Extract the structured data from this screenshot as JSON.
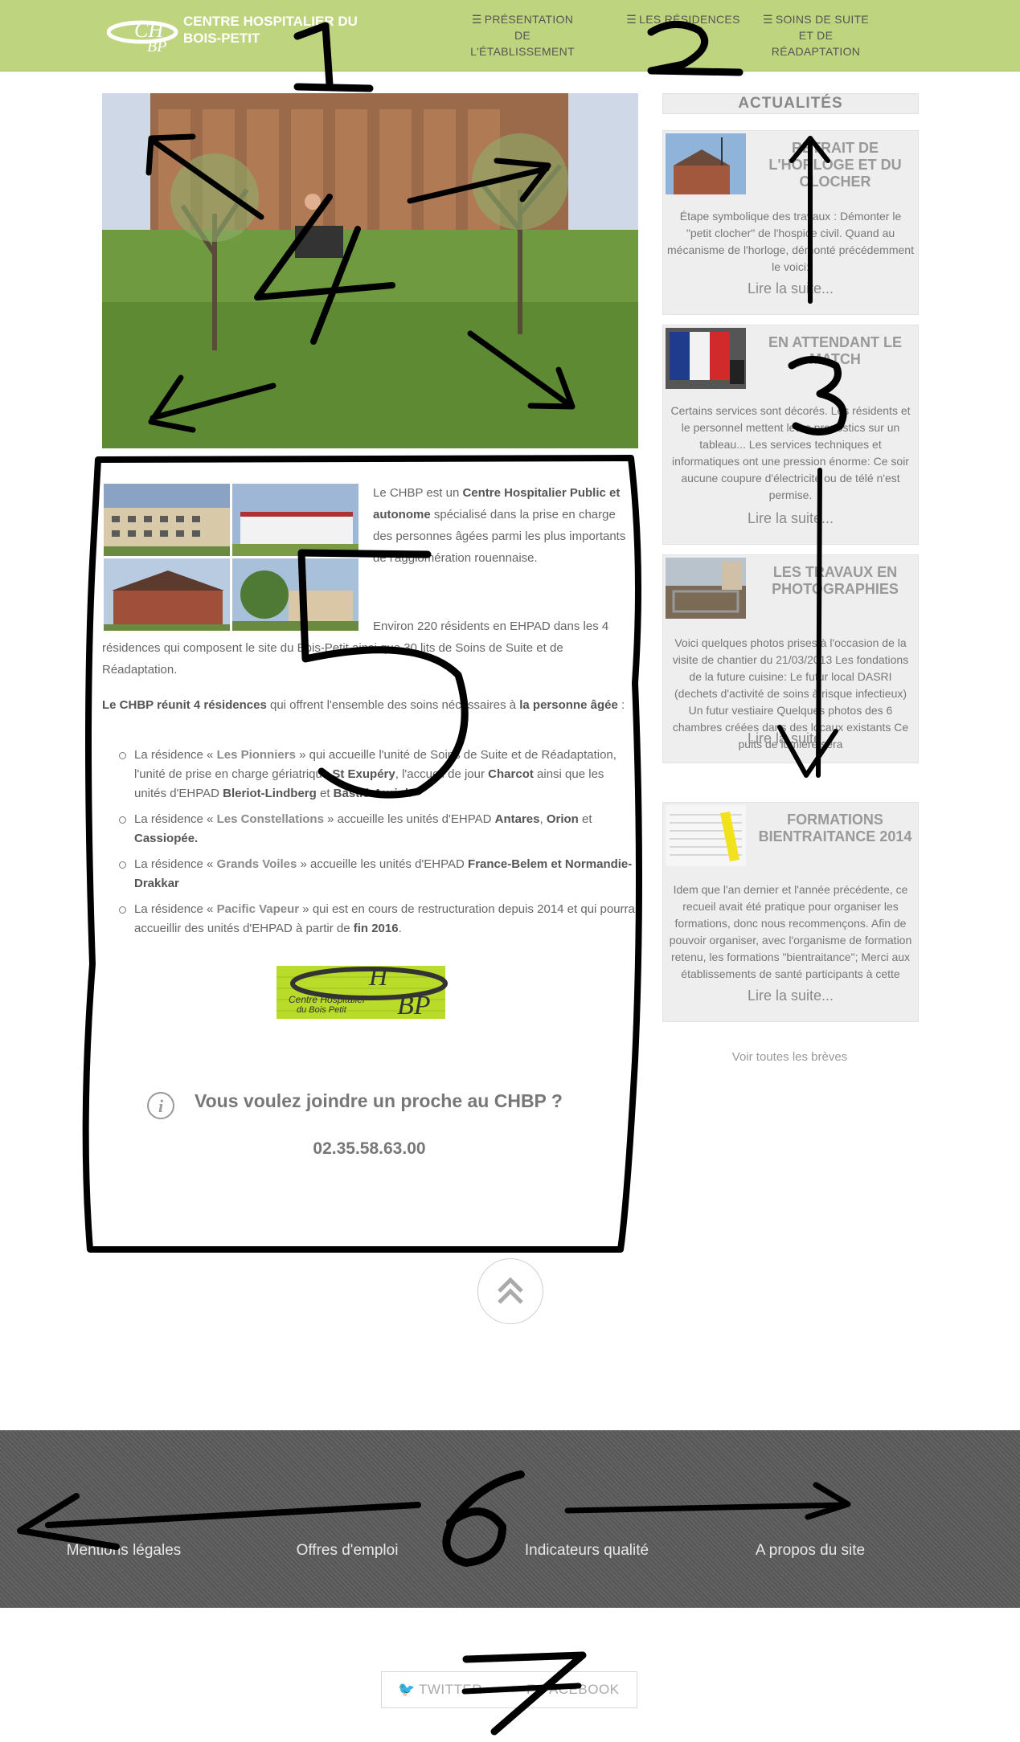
{
  "header": {
    "site_title": "CENTRE HOSPITALIER DU BOIS-PETIT",
    "logo_text": "CHBP",
    "nav": [
      {
        "label_lines": [
          "PRÉSENTATION",
          "DE",
          "L'ÉTABLISSEMENT"
        ]
      },
      {
        "label_lines": [
          "LES RÉSIDENCES"
        ]
      },
      {
        "label_lines": [
          "SOINS DE SUITE",
          "ET DE",
          "RÉADAPTATION"
        ]
      }
    ]
  },
  "main": {
    "p1": {
      "a": "Le CHBP est un ",
      "b": "Centre Hospitalier Public et autonome",
      "c": " spécialisé dans la prise en charge des personnes âgées parmi les plus importants de l'agglomération rouennaise."
    },
    "p2": "Environ 220 résidents en EHPAD dans les 4 résidences qui composent le site du Bois-Petit ainsi que 30 lits de Soins de Suite et de Réadaptation.",
    "p3": {
      "a": "Le CHBP réunit 4 résidences",
      "b": " qui offrent l'ensemble des soins nécessaires à ",
      "c": "la personne âgée",
      "d": " :"
    },
    "bullets": [
      {
        "t1": "La résidence « ",
        "name": "Les Pionniers",
        "t2": " » qui accueille l'unité de Soins de Suite et de Réadaptation, l'unité de prise en charge gériatrique ",
        "k1": "St Exupéry",
        "t3": ", l'accueil de jour ",
        "k2": "Charcot",
        "t4": " ainsi que les unités d'EHPAD ",
        "k3": "Bleriot-Lindberg",
        "t5": " et ",
        "k4": "Bastié-Auriol",
        "t6": "."
      },
      {
        "t1": "La résidence « ",
        "name": "Les Constellations",
        "t2": " » accueille les unités d'EHPAD ",
        "k1": "Antares",
        "t3": ", ",
        "k2": "Orion",
        "t4": " et ",
        "k3": "Cassiopée.",
        "t5": "",
        "k4": "",
        "t6": ""
      },
      {
        "t1": "La résidence « ",
        "name": "Grands Voiles",
        "t2": " » accueille les unités d'EHPAD ",
        "k1": "France-Belem et Normandie-Drakkar",
        "t3": "",
        "k2": "",
        "t4": "",
        "k3": "",
        "t5": "",
        "k4": "",
        "t6": ""
      },
      {
        "t1": "La résidence « ",
        "name": "Pacific Vapeur",
        "t2": " » qui est en cours de restructuration depuis 2014 et qui pourra accueillir des unités d'EHPAD à partir de ",
        "k1": "fin 2016",
        "t3": ".",
        "k2": "",
        "t4": "",
        "k3": "",
        "t5": "",
        "k4": "",
        "t6": ""
      }
    ],
    "bottom_logo": {
      "letters": "CHBP",
      "line1": "Centre Hospitalier",
      "line2": "du Bois Petit"
    },
    "contact_title": "Vous voulez joindre un proche au CHBP ?",
    "phone": "02.35.58.63.00"
  },
  "sidebar": {
    "title": "ACTUALITÉS",
    "cards": [
      {
        "title": "RETRAIT DE L'HORLOGE ET DU CLOCHER",
        "body": "Étape symbolique des travaux : Démonter le \"petit clocher\" de l'hospice civil. Quand au mécanisme de l'horloge, démonté précédemment le voici:",
        "more": "Lire la suite..."
      },
      {
        "title": "EN ATTENDANT LE MATCH",
        "body": "Certains services sont décorés. Les résidents et le personnel mettent leurs pronostics sur un tableau... Les services techniques et informatiques ont une pression énorme: Ce soir aucune coupure d'électricité ou de télé n'est permise.",
        "more": "Lire la suite..."
      },
      {
        "title": "LES TRAVAUX EN PHOTOGRAPHIES",
        "body": "Voici quelques photos prises à l'occasion de la visite de chantier du 21/03/2013 Les fondations de la future cuisine: Le futur local DASRI (dechets d'activité de soins à risque infectieux) Un futur vestiaire Quelques photos des 6 chambres créées dans des locaux existants Ce puits de lumière sera",
        "more": "Lire la suite..."
      },
      {
        "title": "FORMATIONS BIENTRAITANCE 2014",
        "body": "Idem que l'an dernier et l'année précédente, ce recueil avait été pratique pour organiser les formations, donc nous recommençons. Afin de pouvoir organiser, avec l'organisme de formation retenu, les formations \"bientraitance\"; Merci aux établissements de santé participants à cette",
        "more": "Lire la suite..."
      }
    ],
    "see_all": "Voir toutes les brèves"
  },
  "footer": {
    "links": [
      "Mentions légales",
      "Offres d'emploi",
      "Indicateurs qualité",
      "A propos du site"
    ]
  },
  "social": {
    "twitter": "TWITTER",
    "facebook": "FACEBOOK"
  },
  "annotations": [
    "1",
    "2",
    "3",
    "4",
    "5",
    "6",
    "7"
  ]
}
